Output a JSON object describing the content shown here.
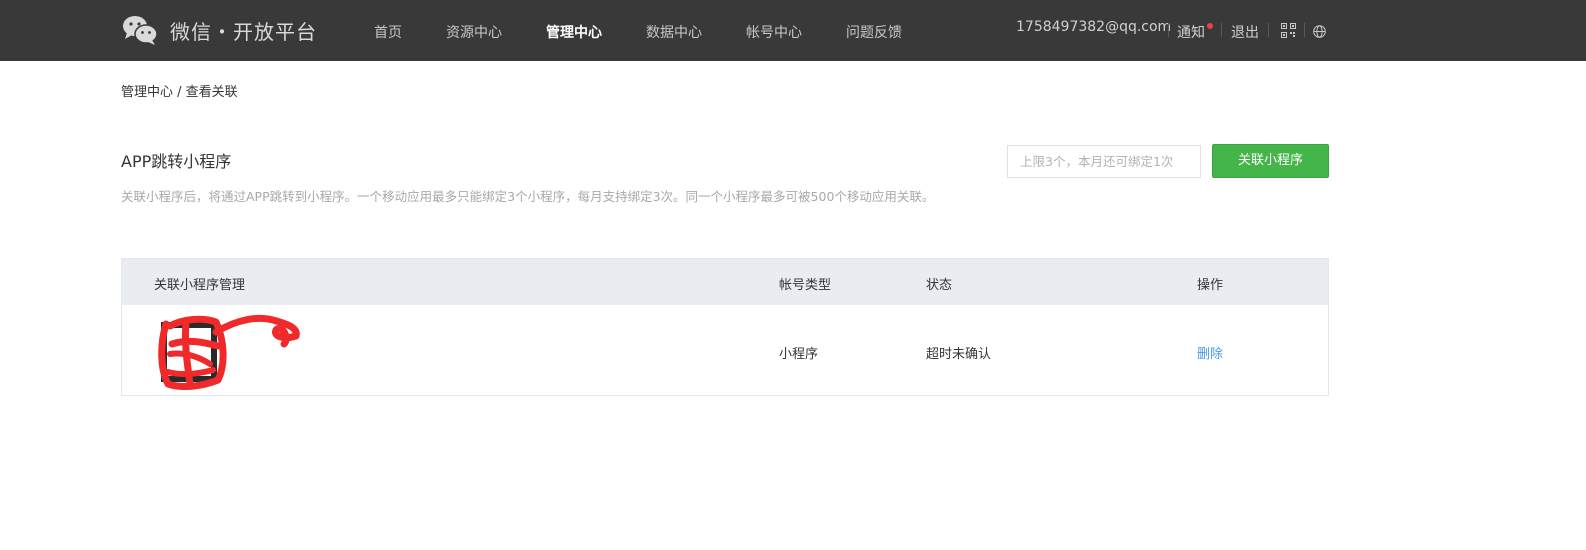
{
  "brand": {
    "logo_icon": "wechat-logo-icon",
    "name": "微信・开放平台"
  },
  "nav": {
    "items": [
      {
        "label": "首页",
        "active": false
      },
      {
        "label": "资源中心",
        "active": false
      },
      {
        "label": "管理中心",
        "active": true
      },
      {
        "label": "数据中心",
        "active": false
      },
      {
        "label": "帐号中心",
        "active": false
      },
      {
        "label": "问题反馈",
        "active": false
      }
    ]
  },
  "account": {
    "email": "1758497382@qq.com",
    "notify_label": "通知",
    "logout_label": "退出",
    "qr_icon": "qr-code-icon",
    "lang_icon": "globe-icon"
  },
  "breadcrumb": {
    "parent": "管理中心",
    "separator": " / ",
    "current": "查看关联"
  },
  "section": {
    "title": "APP跳转小程序",
    "description": "关联小程序后，将通过APP跳转到小程序。一个移动应用最多只能绑定3个小程序，每月支持绑定3次。同一个小程序最多可被500个移动应用关联。",
    "limit_placeholder": "上限3个，本月还可绑定1次",
    "link_button": "关联小程序"
  },
  "table": {
    "headers": [
      "关联小程序管理",
      "帐号类型",
      "状态",
      "操作"
    ],
    "rows": [
      {
        "account_type": "小程序",
        "status": "超时未确认",
        "action": "删除"
      }
    ]
  },
  "colors": {
    "topbar": "#393939",
    "primary": "#44b549",
    "link": "#459ae9",
    "notify_dot": "#e64340"
  }
}
